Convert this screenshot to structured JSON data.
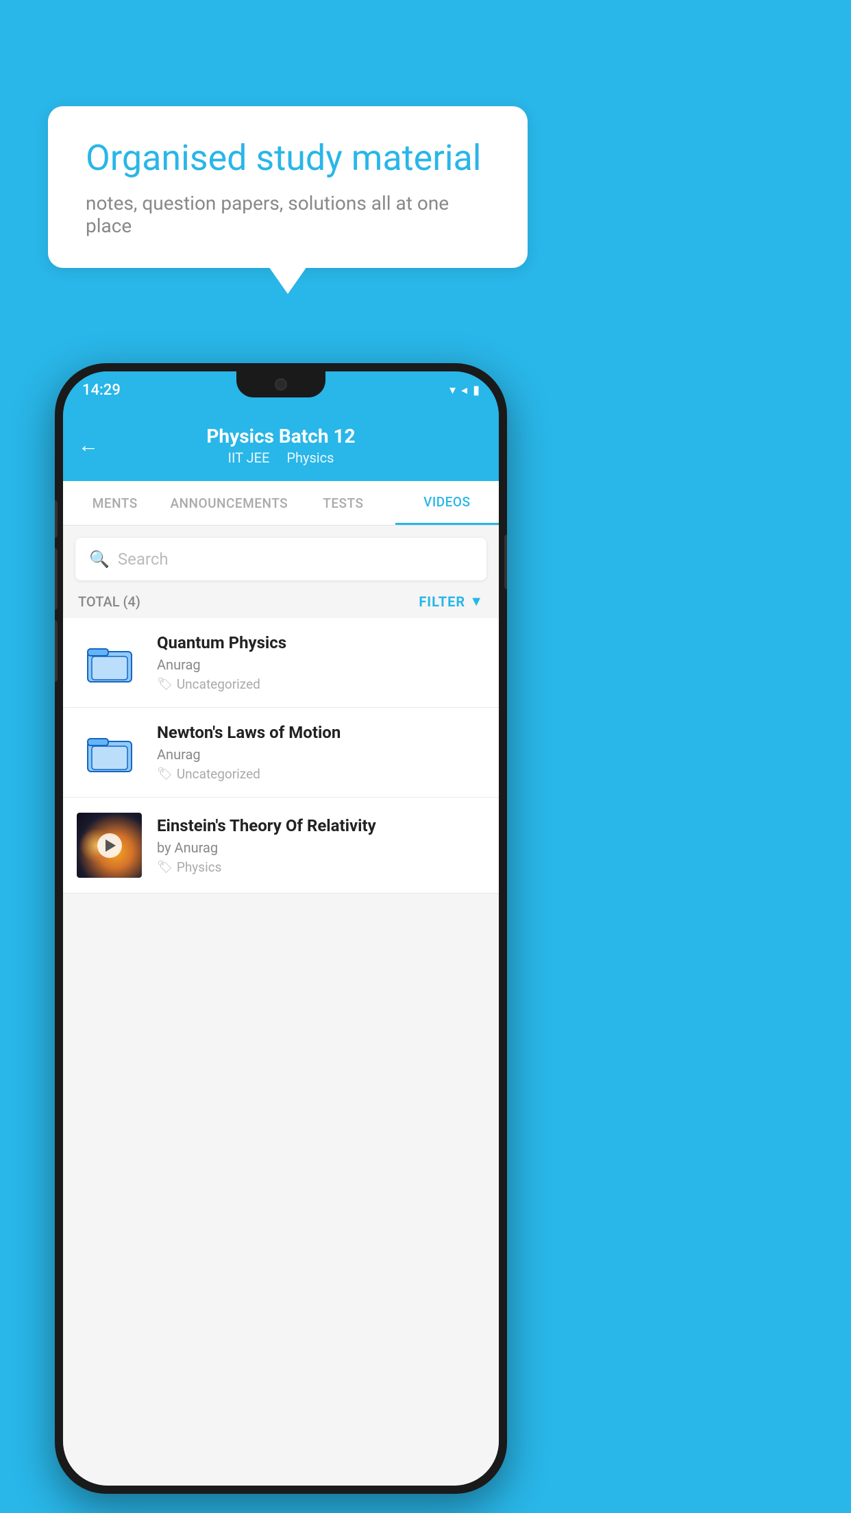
{
  "background": {
    "color": "#29b6e8"
  },
  "bubble": {
    "title": "Organised study material",
    "subtitle": "notes, question papers, solutions all at one place"
  },
  "status_bar": {
    "time": "14:29",
    "icons": "▾◂▮"
  },
  "header": {
    "title": "Physics Batch 12",
    "subtitle1": "IIT JEE",
    "subtitle2": "Physics",
    "back_label": "←"
  },
  "tabs": [
    {
      "label": "MENTS",
      "active": false
    },
    {
      "label": "ANNOUNCEMENTS",
      "active": false
    },
    {
      "label": "TESTS",
      "active": false
    },
    {
      "label": "VIDEOS",
      "active": true
    }
  ],
  "search": {
    "placeholder": "Search"
  },
  "filter_bar": {
    "total": "TOTAL (4)",
    "filter_label": "FILTER"
  },
  "videos": [
    {
      "title": "Quantum Physics",
      "author": "Anurag",
      "tag": "Uncategorized",
      "type": "folder",
      "has_thumbnail": false
    },
    {
      "title": "Newton's Laws of Motion",
      "author": "Anurag",
      "tag": "Uncategorized",
      "type": "folder",
      "has_thumbnail": false
    },
    {
      "title": "Einstein's Theory Of Relativity",
      "author": "by Anurag",
      "tag": "Physics",
      "type": "video",
      "has_thumbnail": true
    }
  ]
}
